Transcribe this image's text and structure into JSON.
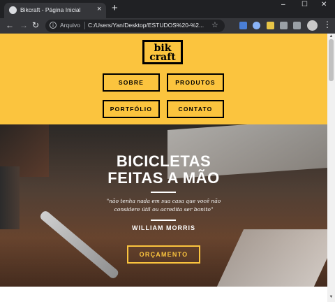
{
  "browser": {
    "tab_title": "Bikcraft - Página Inicial",
    "tab_close": "×",
    "new_tab": "+",
    "window_controls": {
      "minimize": "–",
      "maximize": "☐",
      "close": "✕"
    },
    "nav": {
      "back": "←",
      "forward": "→",
      "reload": "↻"
    },
    "address": {
      "protocol_label": "Arquivo",
      "url": "C:/Users/Yan/Desktop/ESTUDOS%20-%2..."
    },
    "bookmark_star": "☆",
    "menu": "⋮",
    "scrollbar_up": "▲",
    "scrollbar_down": "▼"
  },
  "site": {
    "logo": {
      "line1": "bik",
      "line2": "craft"
    },
    "nav": [
      "SOBRE",
      "PRODUTOS",
      "PORTFÓLIO",
      "CONTATO"
    ],
    "hero": {
      "title_line1": "BICICLETAS",
      "title_line2": "FEITAS A MÃO",
      "quote": "\"não tenha nada em sua casa que você não considere útil ou acredita ser bonito\"",
      "author": "WILLIAM MORRIS",
      "cta": "ORÇAMENTO"
    }
  },
  "colors": {
    "brand_yellow": "#fbc43e",
    "chrome_dark": "#202124",
    "chrome_toolbar": "#35363a"
  }
}
